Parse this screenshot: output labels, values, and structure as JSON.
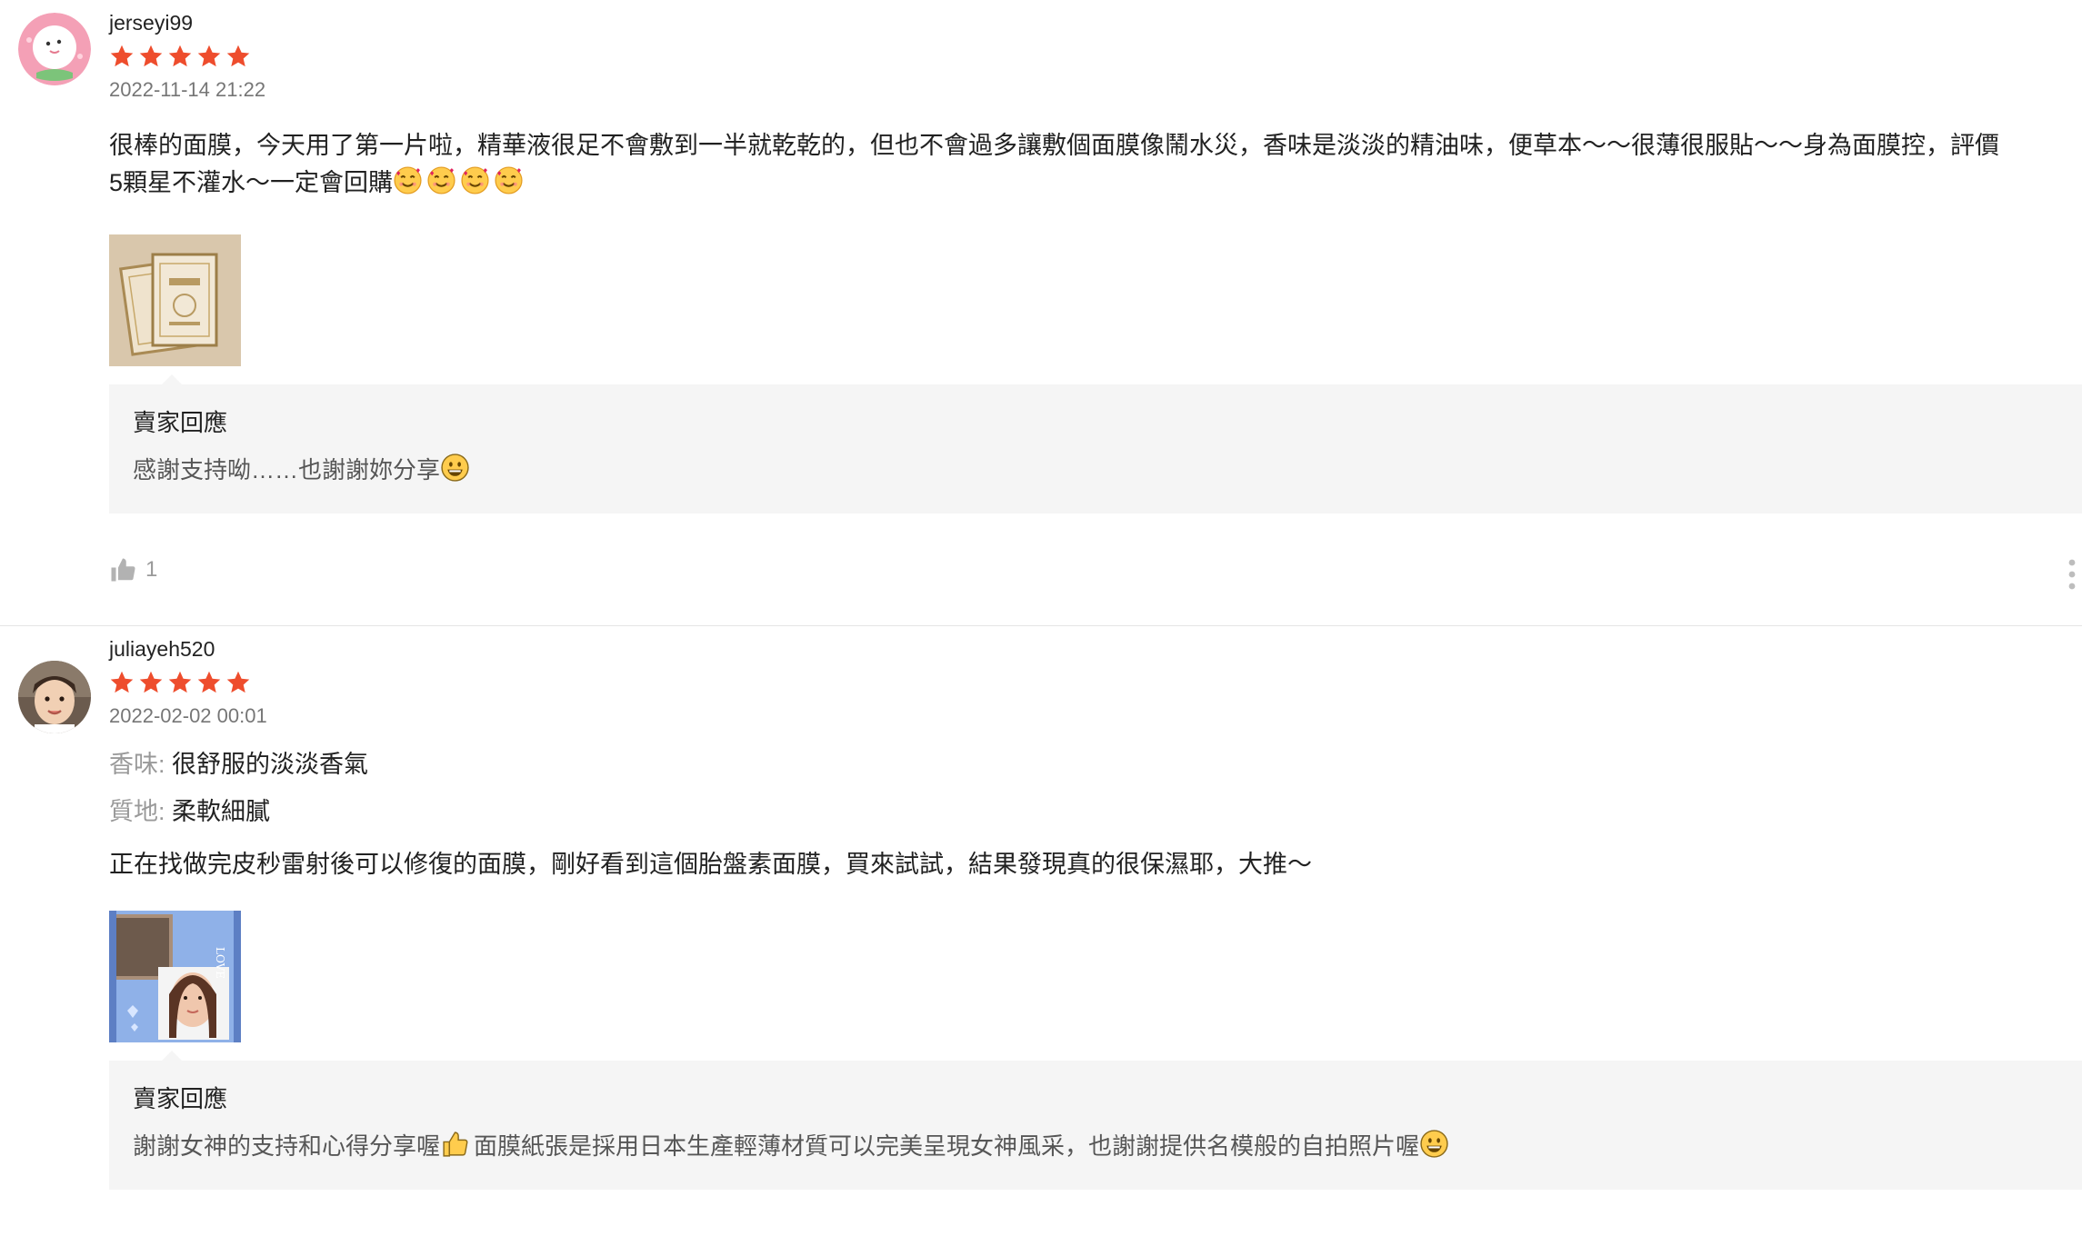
{
  "reviews": [
    {
      "username": "jerseyi99",
      "rating": 5,
      "date": "2022-11-14 21:22",
      "content_line1": "很棒的面膜，今天用了第一片啦，精華液很足不會敷到一半就乾乾的，但也不會過多讓敷個面膜像鬧水災，香味是淡淡的精油味，便草本～～很薄很服貼～～身為面膜控，評價",
      "content_line2": "5顆星不灌水～一定會回購",
      "content_emojis": [
        "smiling-face-with-hearts",
        "smiling-face-with-hearts",
        "smiling-face-with-hearts",
        "smiling-face-with-hearts"
      ],
      "seller_reply_title": "賣家回應",
      "seller_reply_text": "感謝支持呦……也謝謝妳分享",
      "like_count": "1"
    },
    {
      "username": "juliayeh520",
      "rating": 5,
      "date": "2022-02-02 00:01",
      "attributes": [
        {
          "label": "香味:",
          "value": "很舒服的淡淡香氣"
        },
        {
          "label": "質地:",
          "value": "柔軟細膩"
        }
      ],
      "content": "正在找做完皮秒雷射後可以修復的面膜，剛好看到這個胎盤素面膜，買來試試，結果發現真的很保濕耶，大推～",
      "seller_reply_title": "賣家回應",
      "seller_reply_text_part1": "謝謝女神的支持和心得分享喔",
      "seller_reply_text_part2": "面膜紙張是採用日本生產輕薄材質可以完美呈現女神風采，也謝謝提供名模般的自拍照片喔"
    }
  ],
  "colors": {
    "star": "#ee4d2d",
    "reply_bg": "#f5f5f5",
    "divider": "#e5e5e5"
  }
}
